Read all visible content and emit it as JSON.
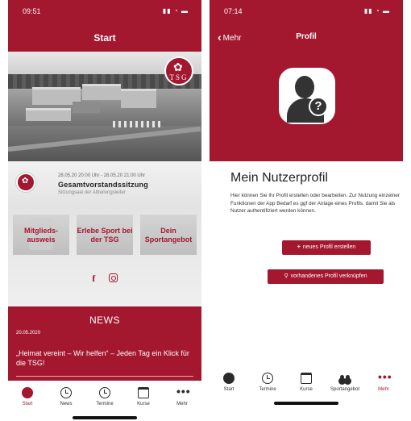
{
  "left": {
    "status_time": "09:51",
    "status_icons": "▮▮ ◔ ▬",
    "nav_title": "Start",
    "logo_text": "TSG",
    "event": {
      "date": "28.05.20 20:00 Uhr - 28.05.20 21:00 Uhr",
      "title": "Gesamtvorstandssitzung",
      "subtitle": "Sitzungsaal der Abteilungsleiter"
    },
    "tiles": [
      {
        "label": "Mitglieds-ausweis"
      },
      {
        "label": "Erlebe Sport bei der TSG"
      },
      {
        "label": "Dein Sportangebot"
      }
    ],
    "social_fb": "f",
    "news": {
      "heading": "NEWS",
      "date": "20.05.2020",
      "headline": "„Heimat vereint – Wir helfen“ – Jeden Tag ein Klick für die TSG!"
    },
    "tabs": [
      {
        "label": "Start",
        "icon": "dot-icon"
      },
      {
        "label": "News",
        "icon": "history-icon"
      },
      {
        "label": "Termine",
        "icon": "clock-icon"
      },
      {
        "label": "Kurse",
        "icon": "calendar-icon"
      },
      {
        "label": "Mehr",
        "icon": "more-icon"
      }
    ]
  },
  "right": {
    "status_time": "07:14",
    "status_icons": "▮▮ ◔ ▬",
    "back_label": "Mehr",
    "nav_title": "Profil",
    "title": "Mein Nutzerprofil",
    "description": "Hier können Sie Ihr Profil erstellen oder bearbeiten. Zur Nutzung einzelner Funktionen der App Bedarf es ggf der Anlage eines Profils, damit Sie als Nutzer authentifiziert werden können.",
    "btn_new": "neues Profil erstellen",
    "btn_link": "vorhandenes Profil verknüpfen",
    "tabs": [
      {
        "label": "Start",
        "icon": "dot-icon"
      },
      {
        "label": "Termine",
        "icon": "clock-icon"
      },
      {
        "label": "Kurse",
        "icon": "calendar-icon"
      },
      {
        "label": "Sportangebot",
        "icon": "people-icon"
      },
      {
        "label": "Mehr",
        "icon": "more-icon"
      }
    ]
  },
  "colors": {
    "brand": "#a3172f",
    "text": "#222222"
  }
}
